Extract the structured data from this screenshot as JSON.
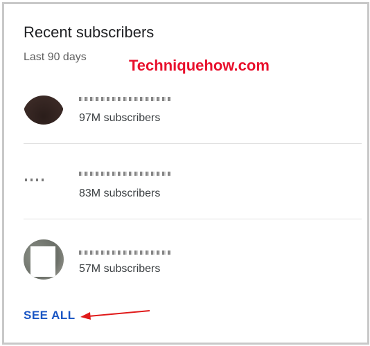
{
  "card": {
    "title": "Recent subscribers",
    "subtitle": "Last 90 days"
  },
  "watermark": "Techniquehow.com",
  "subscribers": [
    {
      "subscribers_text": "97M subscribers"
    },
    {
      "subscribers_text": "83M subscribers"
    },
    {
      "subscribers_text": "57M subscribers"
    }
  ],
  "see_all_label": "SEE ALL",
  "colors": {
    "link": "#1a56c4",
    "watermark": "#e8112d",
    "annotation_arrow": "#e01a1a",
    "divider": "#e0e0e0"
  }
}
